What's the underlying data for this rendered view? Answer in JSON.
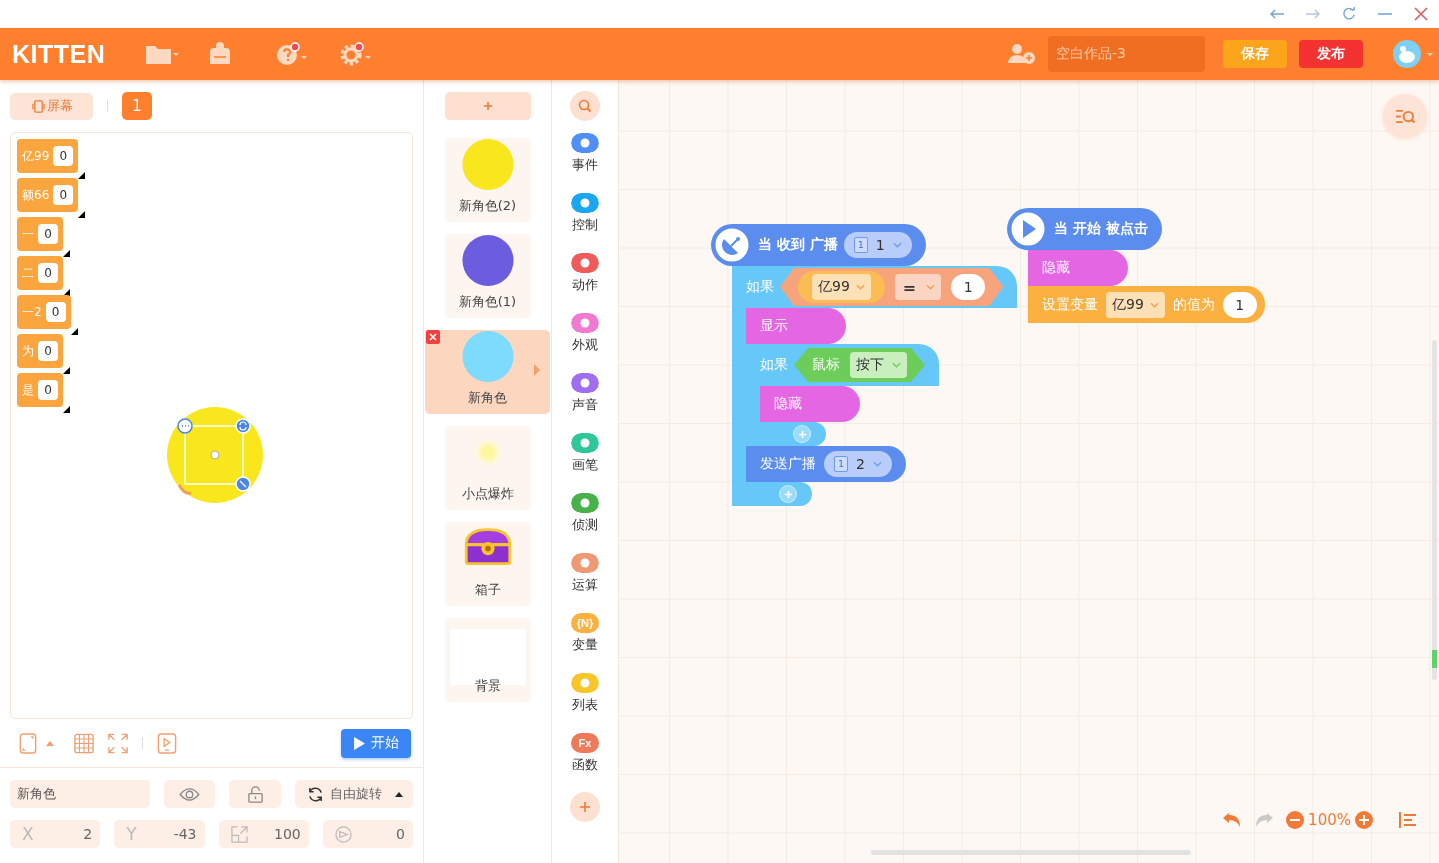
{
  "header": {
    "logo": "KITTEN",
    "project_name": "空白作品-3",
    "save_button": "保存",
    "publish_button": "发布"
  },
  "stage_bar": {
    "screen_button": "屏幕",
    "page": "1"
  },
  "monitors": [
    {
      "name": "亿99",
      "value": "0"
    },
    {
      "name": "额66",
      "value": "0"
    },
    {
      "name": "一",
      "value": "0"
    },
    {
      "name": "二",
      "value": "0"
    },
    {
      "name": "一2",
      "value": "0"
    },
    {
      "name": "为",
      "value": "0"
    },
    {
      "name": "是",
      "value": "0"
    }
  ],
  "start_button": "开始",
  "sprite_info": {
    "name": "新角色",
    "rotation": "自由旋转",
    "fields": [
      {
        "kind": "x",
        "label": "X",
        "value": "2"
      },
      {
        "kind": "y",
        "label": "Y",
        "value": "-43"
      },
      {
        "kind": "size",
        "value": "100"
      },
      {
        "kind": "direction",
        "value": "0"
      }
    ]
  },
  "sprites": [
    {
      "name": "新角色(2)",
      "kind": "circle",
      "color": "#f8e71c",
      "selected": false
    },
    {
      "name": "新角色(1)",
      "kind": "circle",
      "color": "#6c5ce0",
      "selected": false
    },
    {
      "name": "新角色",
      "kind": "circle",
      "color": "#7ddcfd",
      "selected": true
    },
    {
      "name": "小点爆炸",
      "kind": "glow",
      "selected": false
    },
    {
      "name": "箱子",
      "kind": "chest",
      "selected": false
    },
    {
      "name": "背景",
      "kind": "backdrop",
      "selected": false
    }
  ],
  "categories": [
    {
      "label": "事件",
      "color": "#4f8ff7"
    },
    {
      "label": "控制",
      "color": "#1aa6f0"
    },
    {
      "label": "动作",
      "color": "#ef5b5b"
    },
    {
      "label": "外观",
      "color": "#f07ad2"
    },
    {
      "label": "声音",
      "color": "#a06cf0"
    },
    {
      "label": "画笔",
      "color": "#2fc79a"
    },
    {
      "label": "侦测",
      "color": "#47b14c"
    },
    {
      "label": "运算",
      "color": "#ef9a74"
    },
    {
      "label": "变量",
      "color": "#fbb040",
      "glyph": "{N}"
    },
    {
      "label": "列表",
      "color": "#f8c52b"
    },
    {
      "label": "函数",
      "color": "#ef7a5a",
      "glyph": "Fx"
    }
  ],
  "scripts": [
    {
      "hat": {
        "kind": "broadcast",
        "label": "当 收到 广播",
        "message": {
          "badge": "1",
          "value": "1"
        }
      },
      "blocks": [
        {
          "kind": "if",
          "label": "如果",
          "condition": {
            "kind": "compare",
            "variable": "亿99",
            "operator": "=",
            "value": "1"
          },
          "children": [
            {
              "kind": "looks",
              "label": "显示"
            },
            {
              "kind": "if",
              "label": "如果",
              "condition": {
                "kind": "sensing",
                "label": "鼠标",
                "option": "按下"
              },
              "children": [
                {
                  "kind": "looks",
                  "label": "隐藏"
                }
              ]
            },
            {
              "kind": "broadcast",
              "label": "发送广播",
              "message": {
                "badge": "1",
                "value": "2"
              }
            }
          ]
        }
      ]
    },
    {
      "hat": {
        "kind": "play",
        "label": "当 开始 被点击"
      },
      "blocks": [
        {
          "kind": "looks",
          "label": "隐藏"
        },
        {
          "kind": "set_variable",
          "label": "设置变量",
          "variable": "亿99",
          "label_2": "的值为",
          "value": "1"
        }
      ]
    }
  ],
  "zoom": "100%"
}
